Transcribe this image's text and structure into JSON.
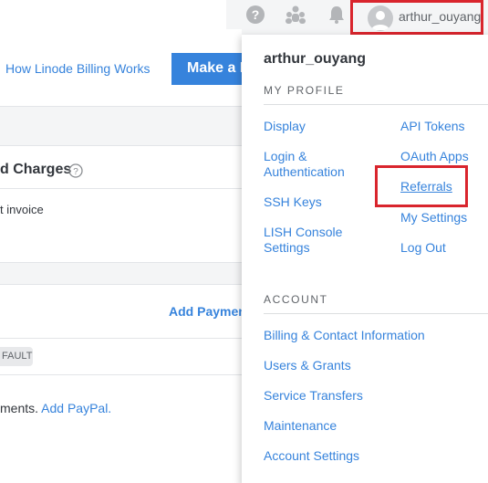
{
  "topbar": {
    "username": "arthur_ouyang",
    "icons": [
      "help-icon",
      "community-icon",
      "notifications-bell-icon",
      "user-avatar-icon"
    ]
  },
  "background": {
    "billing_link": "How Linode Billing Works",
    "make_payment_button": "Make a P",
    "charges_title": "d Charges",
    "invoice_text": "t invoice",
    "add_payment": "Add Payment",
    "default_badge": "FAULT",
    "payment_methods_text": "ments.",
    "add_paypal": "Add PayPal."
  },
  "menu": {
    "username": "arthur_ouyang",
    "my_profile_header": "MY PROFILE",
    "profile_items_left": [
      "Display",
      "Login &\nAuthentication",
      "SSH Keys",
      "LISH Console\nSettings"
    ],
    "profile_items_right": [
      "API Tokens",
      "OAuth Apps",
      "Referrals",
      "My Settings",
      "Log Out"
    ],
    "account_header": "ACCOUNT",
    "account_items": [
      "Billing & Contact Information",
      "Users & Grants",
      "Service Transfers",
      "Maintenance",
      "Account Settings"
    ]
  },
  "colors": {
    "link": "#3683dc",
    "highlight": "#d9252d",
    "button": "#3683dc"
  }
}
